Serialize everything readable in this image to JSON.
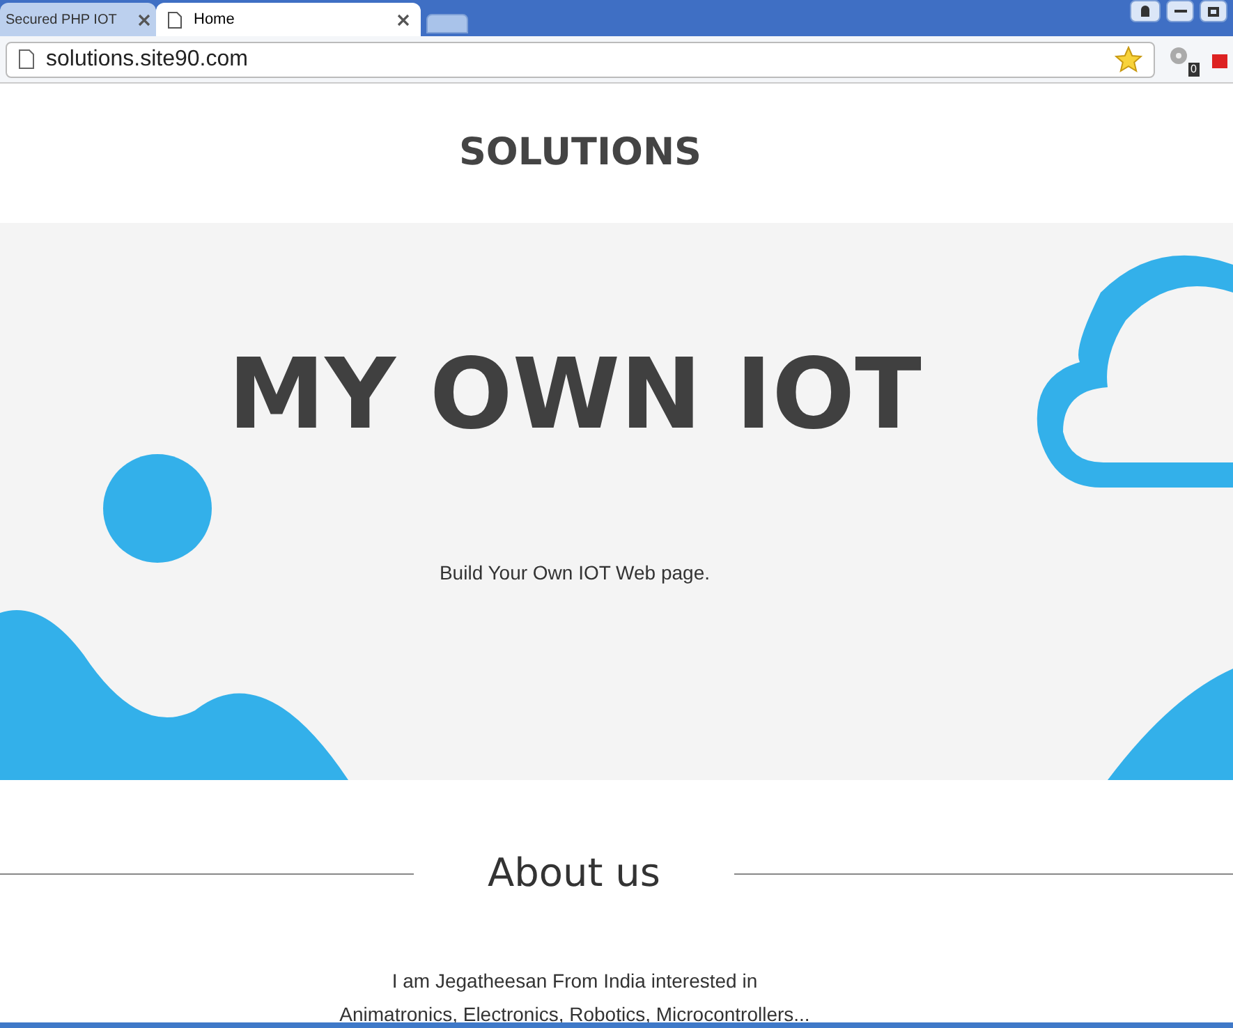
{
  "browser": {
    "tabs": [
      {
        "title": "Secured PHP IOT",
        "selected": false
      },
      {
        "title": "Home",
        "selected": true
      }
    ],
    "address": "solutions.site90.com",
    "extension_badge": "0"
  },
  "site": {
    "brand": "SOLUTIONS"
  },
  "hero": {
    "title": "MY OWN IOT",
    "subtitle": "Build Your Own IOT Web page."
  },
  "about": {
    "heading": "About us",
    "lines": [
      "I am Jegatheesan From India interested in",
      "Animatronics, Electronics, Robotics, Microcontrollers..."
    ]
  }
}
